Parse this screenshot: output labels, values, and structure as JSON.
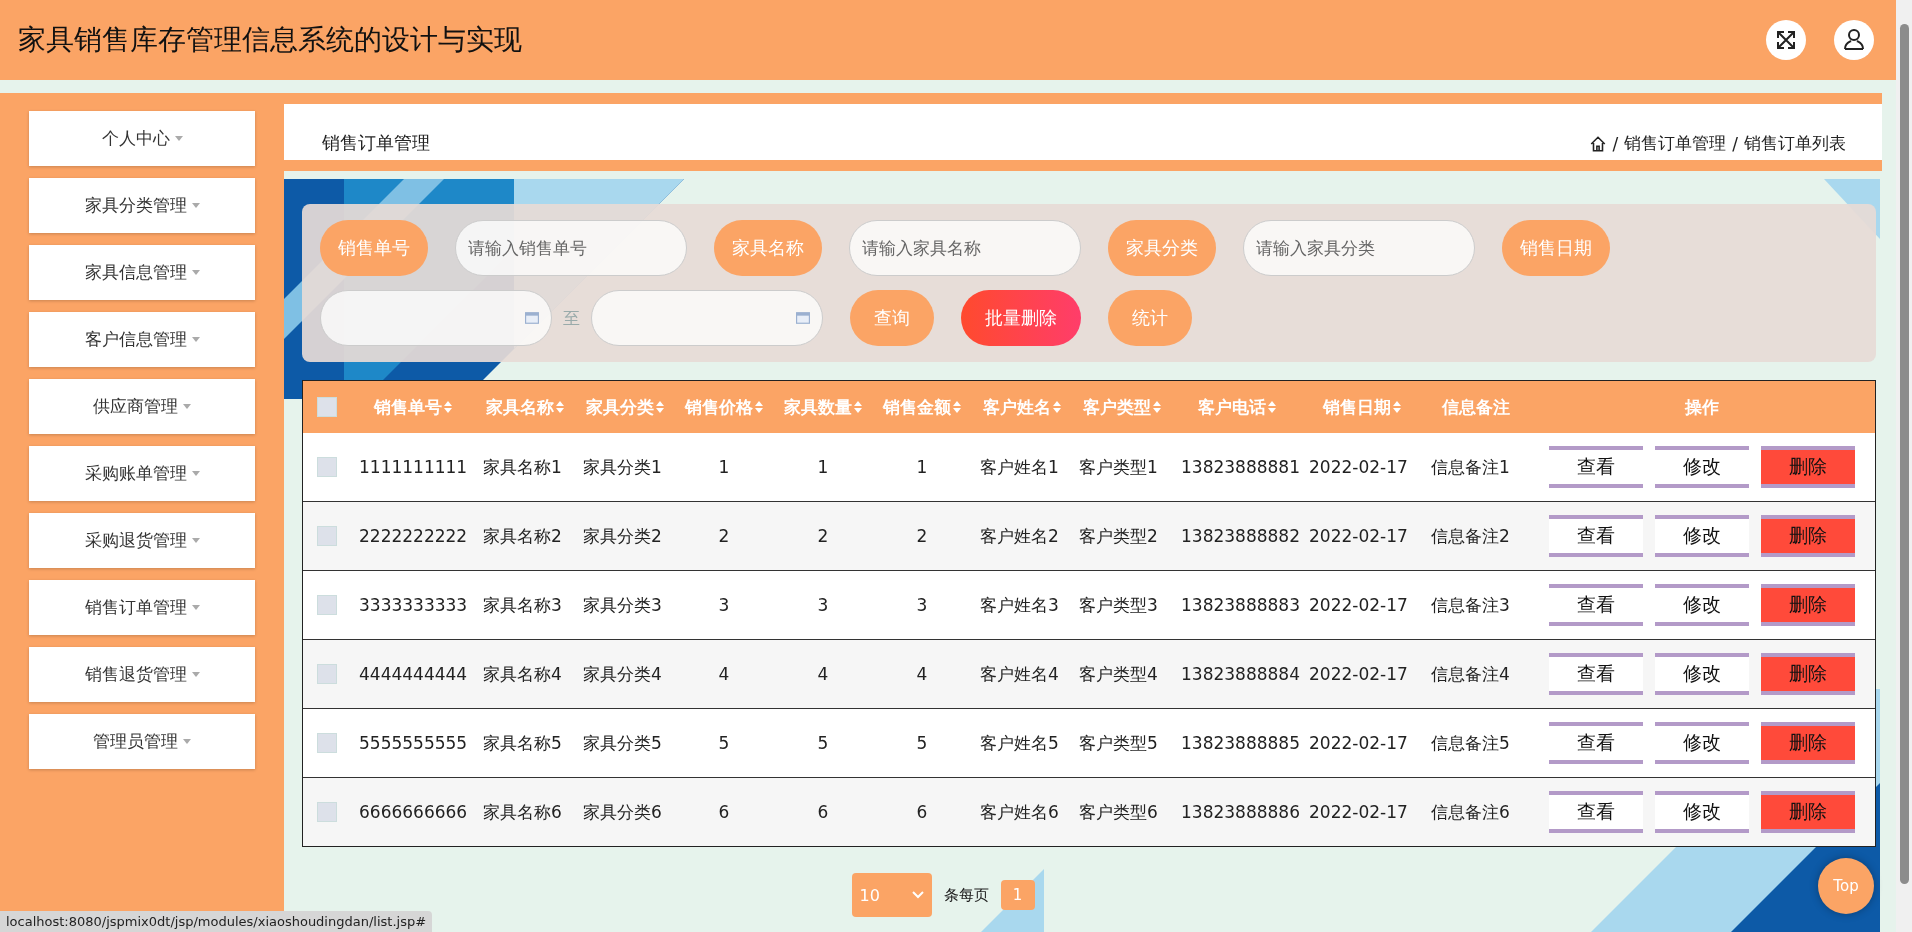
{
  "header": {
    "title": "家具销售库存管理信息系统的设计与实现"
  },
  "sidebar": {
    "items": [
      {
        "label": "个人中心"
      },
      {
        "label": "家具分类管理"
      },
      {
        "label": "家具信息管理"
      },
      {
        "label": "客户信息管理"
      },
      {
        "label": "供应商管理"
      },
      {
        "label": "采购账单管理"
      },
      {
        "label": "采购退货管理"
      },
      {
        "label": "销售订单管理"
      },
      {
        "label": "销售退货管理"
      },
      {
        "label": "管理员管理"
      }
    ]
  },
  "breadcrumb": {
    "page_title": "销售订单管理",
    "path": [
      {
        "separator": "/",
        "label": "销售订单管理"
      },
      {
        "separator": "/",
        "label": "销售订单列表"
      }
    ]
  },
  "search": {
    "fields": [
      {
        "kind": "text",
        "label": "销售单号",
        "placeholder": "请输入销售单号"
      },
      {
        "kind": "text",
        "label": "家具名称",
        "placeholder": "请输入家具名称"
      },
      {
        "kind": "text",
        "label": "家具分类",
        "placeholder": "请输入家具分类"
      },
      {
        "kind": "date_range",
        "label": "销售日期",
        "separator": "至"
      }
    ],
    "buttons": [
      {
        "label": "查询",
        "kind": "primary"
      },
      {
        "label": "批量删除",
        "kind": "danger"
      },
      {
        "label": "统计",
        "kind": "primary"
      }
    ]
  },
  "table": {
    "all_checked": false,
    "columns": [
      "销售单号",
      "家具名称",
      "家具分类",
      "销售价格",
      "家具数量",
      "销售金额",
      "客户姓名",
      "客户类型",
      "客户电话",
      "销售日期",
      "信息备注",
      "操作"
    ],
    "rows": [
      {
        "checked": false,
        "cells": [
          "1111111111",
          "家具名称1",
          "家具分类1",
          "1",
          "1",
          "1",
          "客户姓名1",
          "客户类型1",
          "13823888881",
          "2022-02-17",
          "信息备注1"
        ],
        "actions": [
          {
            "label": "查看",
            "kind": "view"
          },
          {
            "label": "修改",
            "kind": "edit"
          },
          {
            "label": "删除",
            "kind": "delete"
          }
        ]
      },
      {
        "checked": false,
        "cells": [
          "2222222222",
          "家具名称2",
          "家具分类2",
          "2",
          "2",
          "2",
          "客户姓名2",
          "客户类型2",
          "13823888882",
          "2022-02-17",
          "信息备注2"
        ],
        "actions": [
          {
            "label": "查看",
            "kind": "view"
          },
          {
            "label": "修改",
            "kind": "edit"
          },
          {
            "label": "删除",
            "kind": "delete"
          }
        ]
      },
      {
        "checked": false,
        "cells": [
          "3333333333",
          "家具名称3",
          "家具分类3",
          "3",
          "3",
          "3",
          "客户姓名3",
          "客户类型3",
          "13823888883",
          "2022-02-17",
          "信息备注3"
        ],
        "actions": [
          {
            "label": "查看",
            "kind": "view"
          },
          {
            "label": "修改",
            "kind": "edit"
          },
          {
            "label": "删除",
            "kind": "delete"
          }
        ]
      },
      {
        "checked": false,
        "cells": [
          "4444444444",
          "家具名称4",
          "家具分类4",
          "4",
          "4",
          "4",
          "客户姓名4",
          "客户类型4",
          "13823888884",
          "2022-02-17",
          "信息备注4"
        ],
        "actions": [
          {
            "label": "查看",
            "kind": "view"
          },
          {
            "label": "修改",
            "kind": "edit"
          },
          {
            "label": "删除",
            "kind": "delete"
          }
        ]
      },
      {
        "checked": false,
        "cells": [
          "5555555555",
          "家具名称5",
          "家具分类5",
          "5",
          "5",
          "5",
          "客户姓名5",
          "客户类型5",
          "13823888885",
          "2022-02-17",
          "信息备注5"
        ],
        "actions": [
          {
            "label": "查看",
            "kind": "view"
          },
          {
            "label": "修改",
            "kind": "edit"
          },
          {
            "label": "删除",
            "kind": "delete"
          }
        ]
      },
      {
        "checked": false,
        "cells": [
          "6666666666",
          "家具名称6",
          "家具分类6",
          "6",
          "6",
          "6",
          "客户姓名6",
          "客户类型6",
          "13823888886",
          "2022-02-17",
          "信息备注6"
        ],
        "actions": [
          {
            "label": "查看",
            "kind": "view"
          },
          {
            "label": "修改",
            "kind": "edit"
          },
          {
            "label": "删除",
            "kind": "delete"
          }
        ]
      }
    ]
  },
  "pagination": {
    "page_size": "10",
    "page_size_label": "条每页",
    "pages": [
      {
        "label": "1",
        "selected": true
      }
    ]
  },
  "back_to_top": "Top",
  "status_url": "localhost:8080/jspmix0dt/jsp/modules/xiaoshoudingdan/list.jsp#"
}
